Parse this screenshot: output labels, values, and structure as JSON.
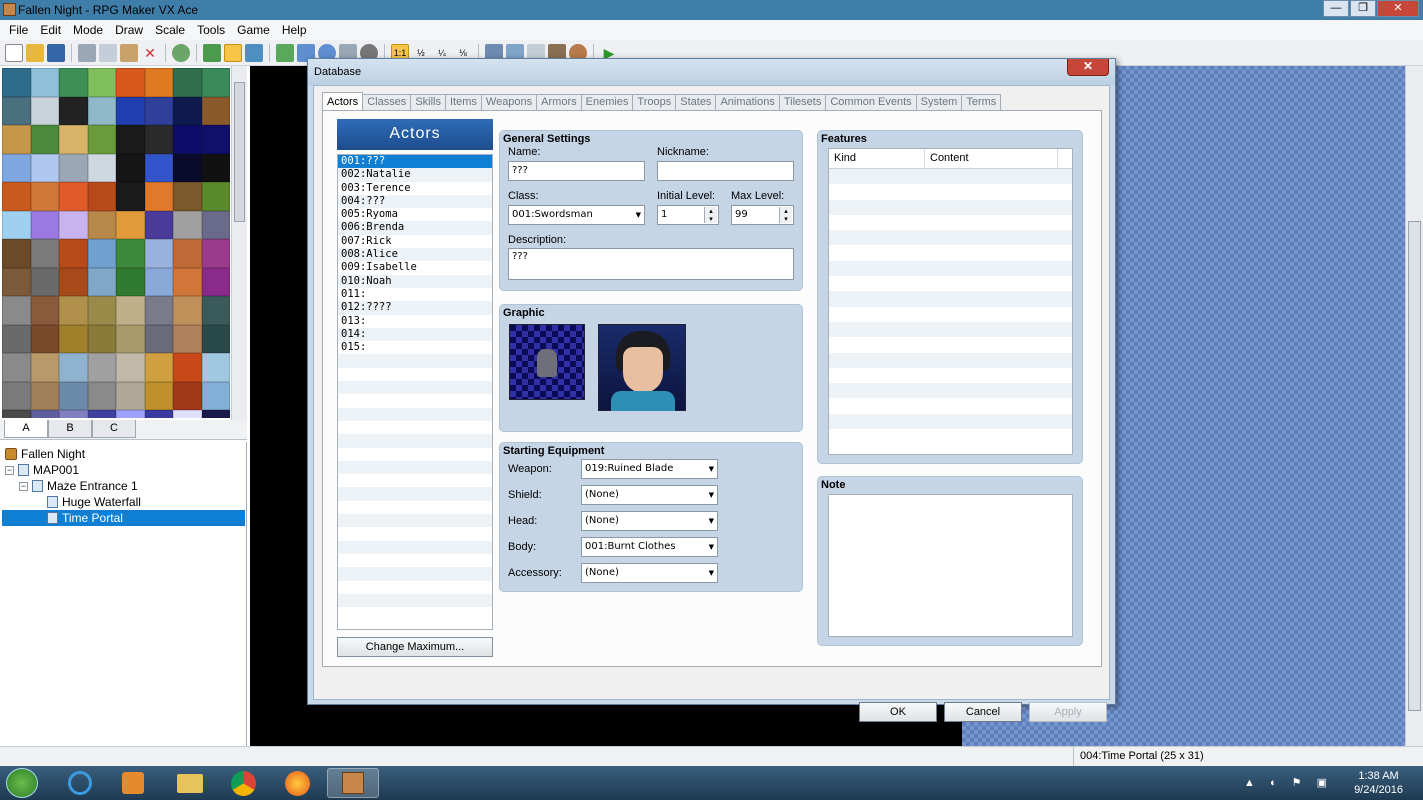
{
  "window": {
    "title": "Fallen Night - RPG Maker VX Ace",
    "min": "—",
    "max": "❐",
    "close": "✕"
  },
  "menu": [
    "File",
    "Edit",
    "Mode",
    "Draw",
    "Scale",
    "Tools",
    "Game",
    "Help"
  ],
  "tileset_tabs": [
    "A",
    "B",
    "C"
  ],
  "map_tree": {
    "project": "Fallen Night",
    "map1": "MAP001",
    "map2": "Maze Entrance 1",
    "map3": "Huge Waterfall",
    "map4": "Time Portal"
  },
  "status": {
    "map_info": "004:Time Portal (25 x 31)"
  },
  "clock": {
    "time": "1:38 AM",
    "date": "9/24/2016"
  },
  "dialog": {
    "title": "Database",
    "tabs": [
      "Actors",
      "Classes",
      "Skills",
      "Items",
      "Weapons",
      "Armors",
      "Enemies",
      "Troops",
      "States",
      "Animations",
      "Tilesets",
      "Common Events",
      "System",
      "Terms"
    ],
    "actors_header": "Actors",
    "actors": [
      "001:???",
      "002:Natalie",
      "003:Terence",
      "004:???",
      "005:Ryoma",
      "006:Brenda",
      "007:Rick",
      "008:Alice",
      "009:Isabelle",
      "010:Noah",
      "011:",
      "012:????",
      "013:",
      "014:",
      "015:"
    ],
    "change_max": "Change Maximum...",
    "general": {
      "title": "General Settings",
      "name_label": "Name:",
      "name_value": "???",
      "nickname_label": "Nickname:",
      "nickname_value": "",
      "class_label": "Class:",
      "class_value": "001:Swordsman",
      "init_level_label": "Initial Level:",
      "init_level_value": "1",
      "max_level_label": "Max Level:",
      "max_level_value": "99",
      "desc_label": "Description:",
      "desc_value": "???"
    },
    "graphic": {
      "title": "Graphic"
    },
    "equipment": {
      "title": "Starting Equipment",
      "weapon_label": "Weapon:",
      "weapon_value": "019:Ruined Blade",
      "shield_label": "Shield:",
      "shield_value": "(None)",
      "head_label": "Head:",
      "head_value": "(None)",
      "body_label": "Body:",
      "body_value": "001:Burnt Clothes",
      "accessory_label": "Accessory:",
      "accessory_value": "(None)"
    },
    "features": {
      "title": "Features",
      "col_kind": "Kind",
      "col_content": "Content"
    },
    "note": {
      "title": "Note"
    },
    "buttons": {
      "ok": "OK",
      "cancel": "Cancel",
      "apply": "Apply"
    }
  }
}
